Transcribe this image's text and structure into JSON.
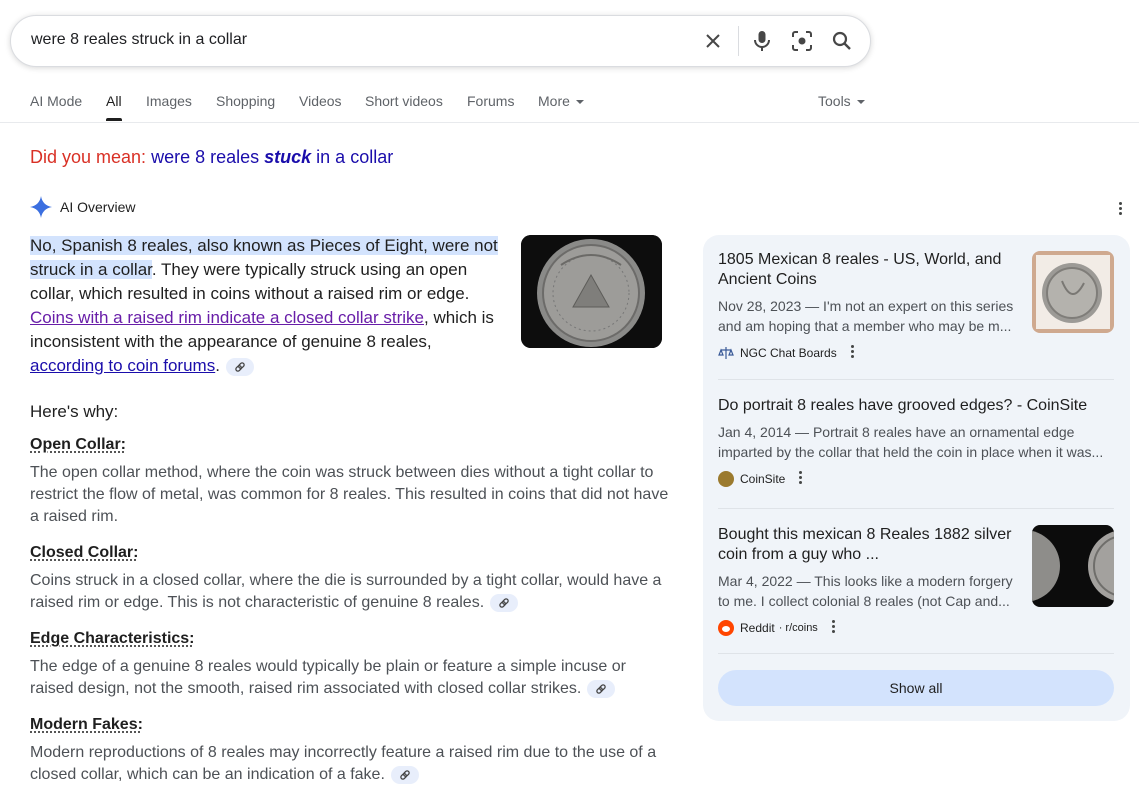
{
  "search": {
    "query": "were 8 reales struck in a collar"
  },
  "tabs": [
    {
      "label": "AI Mode"
    },
    {
      "label": "All"
    },
    {
      "label": "Images"
    },
    {
      "label": "Shopping"
    },
    {
      "label": "Videos"
    },
    {
      "label": "Short videos"
    },
    {
      "label": "Forums"
    },
    {
      "label": "More"
    }
  ],
  "tools_label": "Tools",
  "did_you_mean": {
    "label": "Did you mean:",
    "pre": "were 8 reales ",
    "emph": "stuck",
    "post": " in a collar"
  },
  "ai_overview": {
    "title": "AI Overview",
    "answer_highlight": "No, Spanish 8 reales, also known as Pieces of Eight, were not struck in a collar",
    "answer_part1": ". They were typically struck using an open collar, which resulted in coins without a raised rim or edge. ",
    "answer_link1": "Coins with a raised rim indicate a closed collar strike",
    "answer_part2": ", which is inconsistent with the appearance of genuine 8 reales, ",
    "answer_link2": "according to coin forums",
    "answer_part3": ".",
    "heres_why": "Here's why:",
    "sections": [
      {
        "title": "Open Collar:",
        "body": "The open collar method, where the coin was struck between dies without a tight collar to restrict the flow of metal, was common for 8 reales. This resulted in coins that did not have a raised rim."
      },
      {
        "title": "Closed Collar:",
        "body": "Coins struck in a closed collar, where the die is surrounded by a tight collar, would have a raised rim or edge. This is not characteristic of genuine 8 reales."
      },
      {
        "title": "Edge Characteristics:",
        "body": "The edge of a genuine 8 reales would typically be plain or feature a simple incuse or raised design, not the smooth, raised rim associated with closed collar strikes."
      },
      {
        "title": "Modern Fakes:",
        "body": "Modern reproductions of 8 reales may incorrectly feature a raised rim due to the use of a closed collar, which can be an indication of a fake."
      }
    ]
  },
  "sources": [
    {
      "title": "1805 Mexican 8 reales - US, World, and Ancient Coins",
      "snippet": "Nov 28, 2023 — I'm not an expert on this series and am hoping that a member who may be m...",
      "site": "NGC Chat Boards"
    },
    {
      "title": "Do portrait 8 reales have grooved edges? - CoinSite",
      "snippet": "Jan 4, 2014 — Portrait 8 reales have an ornamental edge imparted by the collar that held the coin in place when it was...",
      "site": "CoinSite"
    },
    {
      "title": "Bought this mexican 8 Reales 1882 silver coin from a guy who ...",
      "snippet": "Mar 4, 2022 — This looks like a modern forgery to me. I collect colonial 8 reales (not Cap and...",
      "site": "Reddit",
      "sub": "· r/coins"
    }
  ],
  "show_all_label": "Show all",
  "colors": {
    "link": "#1a0dab",
    "visited": "#681da8",
    "did_you_mean": "#d93025",
    "highlight": "#d3e3fd",
    "panel": "#f0f4f9"
  }
}
